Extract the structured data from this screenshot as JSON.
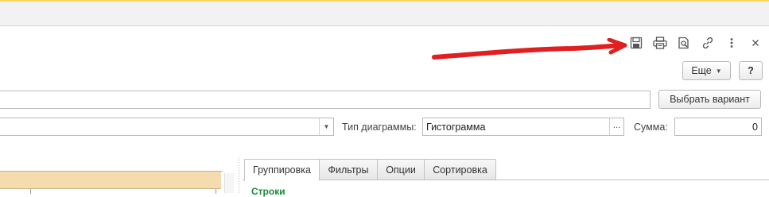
{
  "toolbar": {
    "icons": [
      "save-icon",
      "print-icon",
      "preview-icon",
      "link-icon",
      "more-icon",
      "close-icon"
    ],
    "more_label": "Еще",
    "help_label": "?"
  },
  "variant": {
    "input_value": "",
    "select_button_label": "Выбрать вариант"
  },
  "settings": {
    "period_value": "",
    "chart_type_label": "Тип диаграммы:",
    "chart_type_value": "Гистограмма",
    "chart_type_select_label": "...",
    "sum_label": "Сумма:",
    "sum_value": "0"
  },
  "tabs": [
    {
      "label": "Группировка",
      "active": true
    },
    {
      "label": "Фильтры",
      "active": false
    },
    {
      "label": "Опции",
      "active": false
    },
    {
      "label": "Сортировка",
      "active": false
    }
  ],
  "panel": {
    "rows_label": "Строки"
  },
  "colors": {
    "annotation_arrow": "#e02020",
    "rows_label": "#1b8a3a",
    "table_header": "#f4dcae",
    "top_accent": "#f7d85c"
  }
}
